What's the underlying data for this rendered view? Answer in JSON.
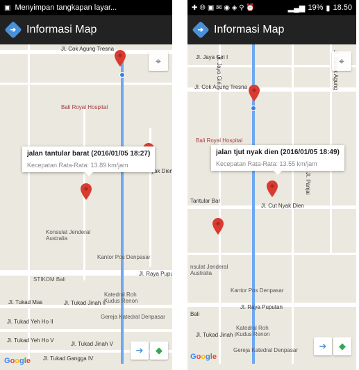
{
  "app": {
    "title": "Informasi Map"
  },
  "left": {
    "status_text": "Menyimpan tangkapan layar...",
    "infowindow": {
      "title": "jalan tantular barat (2016/01/05 18:27)",
      "speed": "Kecepatan Rata-Rata: 13.89 km/jam"
    },
    "streets": {
      "cok_agung": "Jl. Cok Agung Tresna",
      "tukad_mas": "Jl. Tukad Mas",
      "tukad_jinah_ii": "Jl. Tukad Jinah II",
      "tukad_yeh_ho_ii": "Jl. Tukad Yeh Ho II",
      "tukad_yeh_ho_v": "Jl. Tukad Yeh Ho V",
      "tukad_jinah_v": "Jl. Tukad Jinah V",
      "tukad_gangga": "Jl. Tukad Gangga IV",
      "raya_puputan": "Jl. Raya Puput",
      "nyak_dien": "yak Dien"
    },
    "pois": {
      "hospital": "Bali Royal Hospital",
      "konsulat": "Konsulat Jenderal Australia",
      "kantor_pos": "Kantor Pos Denpasar",
      "stikom": "STIKOM Bali",
      "katedral": "Katedral Roh Kudus Renon",
      "gereja": "Gereja Katedral Denpasar"
    }
  },
  "right": {
    "status_time": "18.50",
    "status_battery": "19%",
    "infowindow": {
      "title": "jalan tjut nyak dien (2016/01/05 18:49)",
      "speed": "Kecepatan Rata-Rata: 13.55 km/jam"
    },
    "streets": {
      "jaya_giri_i": "Jl. Jaya Giri I",
      "jaya_giri": "Jl. Jaya Giri",
      "cok_agung": "Jl. Cok Agung Tresna",
      "badak_agung": "Jl. Badak Agung",
      "panjaitan": "Jl. Panjai",
      "tantular": "Tantular Bar",
      "cut_nyak_dien": "Jl. Cut Nyak Dien",
      "raya_puputan": "Jl. Raya Puputan",
      "tukad_jinah_i": "Jl. Tukad Jinah I",
      "bali": "Bali"
    },
    "pois": {
      "hospital": "Bali Royal Hospital",
      "konsulat": "nsulat Jenderal Australia",
      "kantor_pos": "Kantor Pos Denpasar",
      "katedral": "Katedral Roh Kudus Renon",
      "gereja": "Gereja Katedral Denpasar"
    }
  },
  "google_letters": [
    "G",
    "o",
    "o",
    "g",
    "l",
    "e"
  ],
  "colors": {
    "pin": "#d93b30",
    "route": "#6fa8f0",
    "appbar": "#222222",
    "accent": "#4a90d9"
  }
}
